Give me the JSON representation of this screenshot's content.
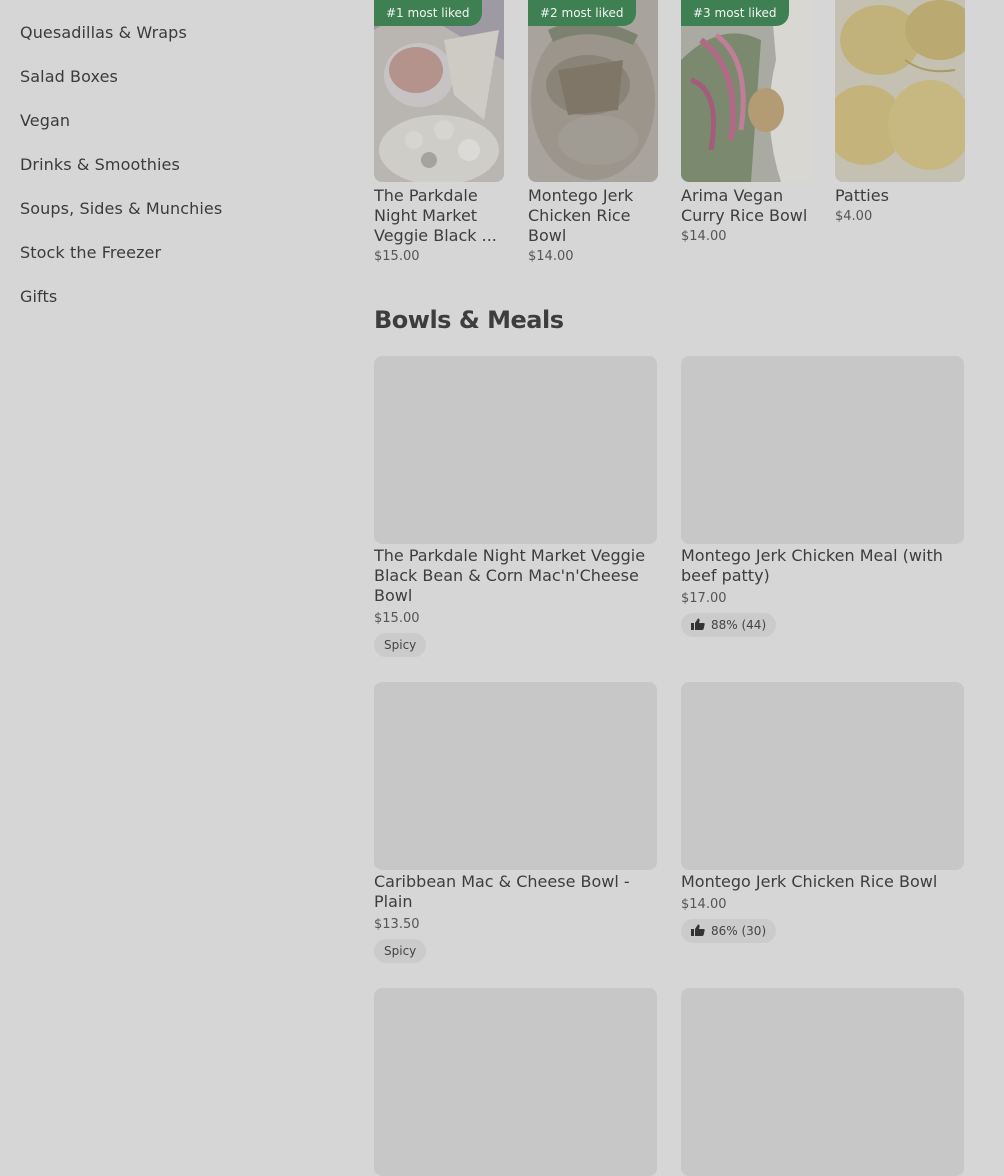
{
  "sidebar": {
    "categories": [
      "Quesadillas & Wraps",
      "Salad Boxes",
      "Vegan",
      "Drinks & Smoothies",
      "Soups, Sides & Munchies",
      "Stock the Freezer",
      "Gifts"
    ]
  },
  "featured": [
    {
      "badge": "#1 most liked",
      "title": "The Parkdale Night Market Veggie Black ...",
      "price": "$15.00"
    },
    {
      "badge": "#2 most liked",
      "title": "Montego Jerk Chicken Rice Bowl",
      "price": "$14.00"
    },
    {
      "badge": "#3 most liked",
      "title": "Arima Vegan Curry Rice Bowl",
      "price": "$14.00"
    },
    {
      "badge": "",
      "title": "Patties",
      "price": "$4.00"
    }
  ],
  "section": {
    "title": "Bowls & Meals"
  },
  "products": [
    {
      "title": "The Parkdale Night Market Veggie Black Bean & Corn Mac'n'Cheese Bowl",
      "price": "$15.00",
      "tag": "Spicy",
      "rating": ""
    },
    {
      "title": "Montego Jerk Chicken Meal (with beef patty)",
      "price": "$17.00",
      "tag": "",
      "rating": "88% (44)"
    },
    {
      "title": "Caribbean Mac & Cheese  Bowl - Plain",
      "price": "$13.50",
      "tag": "Spicy",
      "rating": ""
    },
    {
      "title": "Montego Jerk Chicken Rice Bowl",
      "price": "$14.00",
      "tag": "",
      "rating": "86% (30)"
    }
  ],
  "icons": {
    "rating": "thumbs-up-icon"
  },
  "colors": {
    "badge_bg": "#3f8053",
    "overlay_bg": "#d6d6d6"
  }
}
